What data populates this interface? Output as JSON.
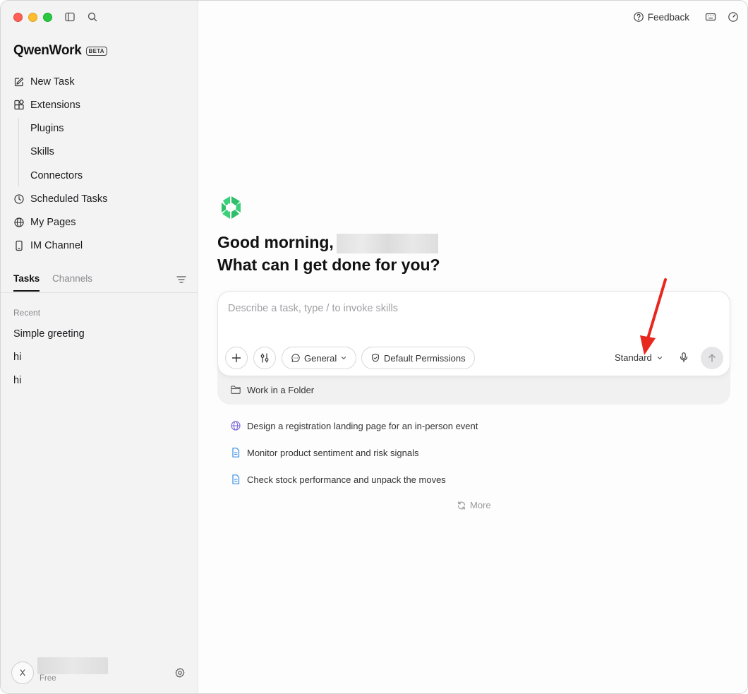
{
  "app": {
    "name": "QwenWork",
    "badge": "BETA"
  },
  "sidebar": {
    "nav": [
      {
        "label": "New Task",
        "icon": "edit-icon"
      },
      {
        "label": "Extensions",
        "icon": "extensions-icon"
      }
    ],
    "extensions_children": [
      "Plugins",
      "Skills",
      "Connectors"
    ],
    "nav_bottom": [
      {
        "label": "Scheduled Tasks",
        "icon": "clock-icon"
      },
      {
        "label": "My Pages",
        "icon": "globe-icon"
      },
      {
        "label": "IM Channel",
        "icon": "phone-icon"
      }
    ],
    "tabs": {
      "tasks": "Tasks",
      "channels": "Channels"
    },
    "recent_label": "Recent",
    "recent": [
      "Simple greeting",
      "hi",
      "hi"
    ],
    "user": {
      "initial": "X",
      "plan": "Free"
    }
  },
  "header": {
    "feedback": "Feedback"
  },
  "main": {
    "greeting_line1": "Good morning,",
    "greeting_line2": "What can I get done for you?",
    "composer": {
      "placeholder": "Describe a task, type / to invoke skills",
      "agent_mode": "General",
      "permissions": "Default Permissions",
      "model_mode": "Standard"
    },
    "folder": "Work in a Folder",
    "suggestions": [
      {
        "text": "Design a registration landing page for an in-person event",
        "icon": "globe-icon"
      },
      {
        "text": "Monitor product sentiment and risk signals",
        "icon": "document-icon"
      },
      {
        "text": "Check stock performance and unpack the moves",
        "icon": "document-icon"
      }
    ],
    "more": "More"
  },
  "colors": {
    "brand_green": "#3ccf7a",
    "annotation_red": "#e8281f"
  }
}
